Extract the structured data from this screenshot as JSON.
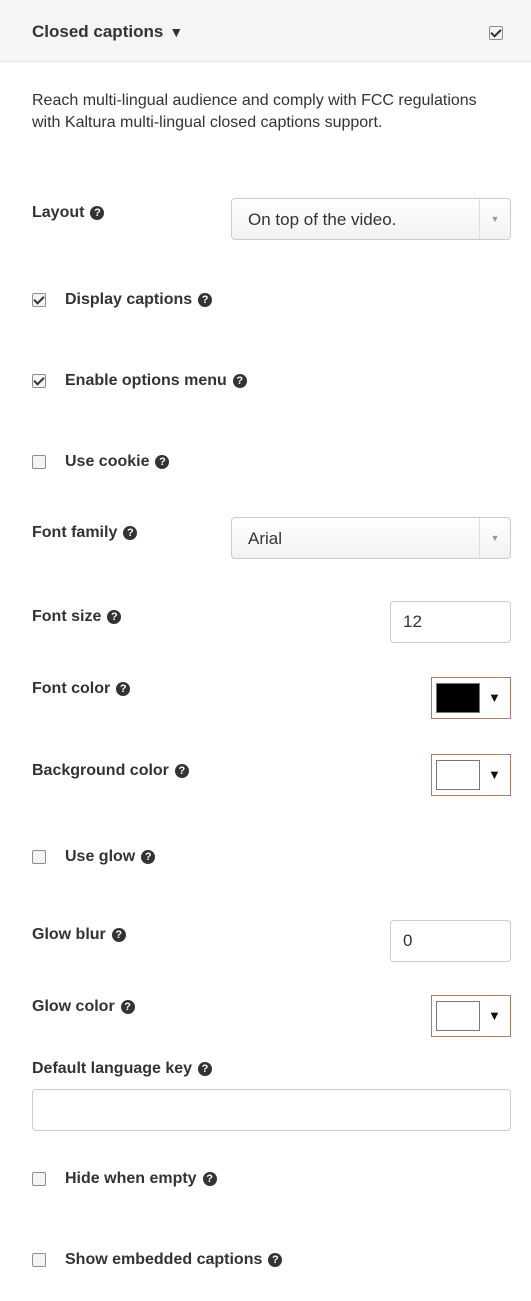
{
  "header": {
    "title": "Closed captions",
    "caret": "▼",
    "enabled": true
  },
  "description": "Reach multi-lingual audience and comply with FCC regulations with Kaltura multi-lingual closed captions support.",
  "help_glyph": "?",
  "layout": {
    "label": "Layout",
    "value": "On top of the video."
  },
  "display_captions": {
    "label": "Display captions",
    "checked": true
  },
  "enable_options_menu": {
    "label": "Enable options menu",
    "checked": true
  },
  "use_cookie": {
    "label": "Use cookie",
    "checked": false
  },
  "font_family": {
    "label": "Font family",
    "value": "Arial"
  },
  "font_size": {
    "label": "Font size",
    "value": "12"
  },
  "font_color": {
    "label": "Font color",
    "color": "#000000",
    "caret": "▼"
  },
  "background_color": {
    "label": "Background color",
    "color": "#ffffff",
    "caret": "▼"
  },
  "use_glow": {
    "label": "Use glow",
    "checked": false
  },
  "glow_blur": {
    "label": "Glow blur",
    "value": "0"
  },
  "glow_color": {
    "label": "Glow color",
    "color": "#ffffff",
    "caret": "▼"
  },
  "default_language_key": {
    "label": "Default language key",
    "value": ""
  },
  "hide_when_empty": {
    "label": "Hide when empty",
    "checked": false
  },
  "show_embedded_captions": {
    "label": "Show embedded captions",
    "checked": false
  },
  "icons": {
    "help": "question-circle-icon",
    "select_arrow": "caret-down-icon",
    "color_caret": "triangle-down-icon"
  }
}
